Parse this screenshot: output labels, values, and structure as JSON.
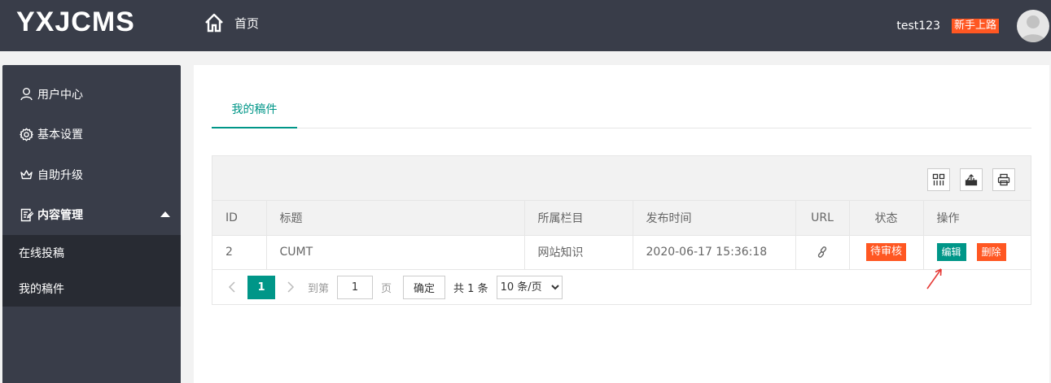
{
  "header": {
    "logo": "YXJCMS",
    "home_label": "首页",
    "username": "test123",
    "badge": "新手上路"
  },
  "sidebar": {
    "items": [
      {
        "label": "用户中心",
        "icon": "user-icon"
      },
      {
        "label": "基本设置",
        "icon": "gear-icon"
      },
      {
        "label": "自助升级",
        "icon": "crown-icon"
      },
      {
        "label": "内容管理",
        "icon": "document-edit-icon"
      }
    ],
    "subitems": [
      {
        "label": "在线投稿"
      },
      {
        "label": "我的稿件"
      }
    ]
  },
  "main": {
    "tab": "我的稿件",
    "toolbar_icons": [
      "columns-icon",
      "export-icon",
      "print-icon"
    ],
    "table": {
      "columns": [
        "ID",
        "标题",
        "所属栏目",
        "发布时间",
        "URL",
        "状态",
        "操作"
      ],
      "rows": [
        {
          "id": "2",
          "title": "CUMT",
          "category": "网站知识",
          "time": "2020-06-17 15:36:18",
          "url_icon": "link-icon",
          "status": "待审核",
          "edit": "编辑",
          "delete": "删除"
        }
      ]
    },
    "pager": {
      "current": "1",
      "goto_label": "到第",
      "page_value": "1",
      "page_unit": "页",
      "confirm": "确定",
      "total": "共 1 条",
      "per_page": "10 条/页"
    }
  },
  "colors": {
    "header_bg": "#393d49",
    "accent": "#009688",
    "danger": "#ff5722"
  }
}
